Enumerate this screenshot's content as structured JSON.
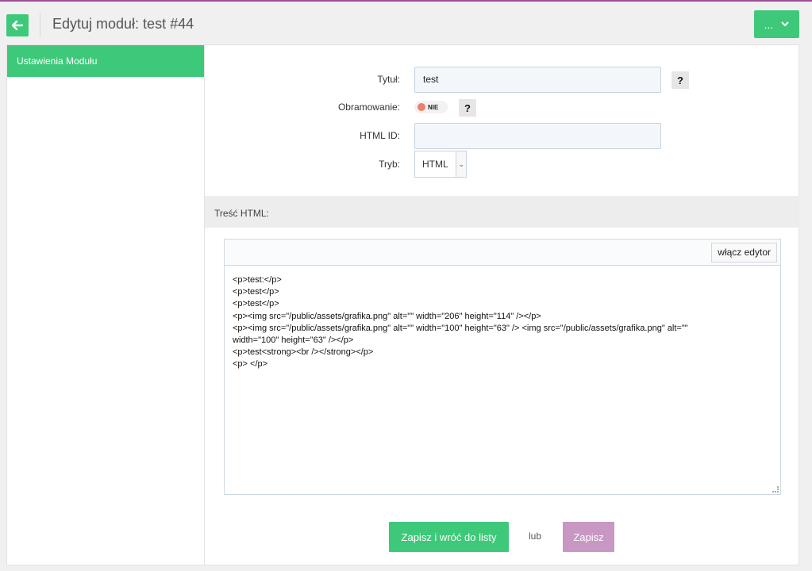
{
  "header": {
    "title": "Edytuj moduł: test #44",
    "more_label": "...",
    "accent_color": "#3ec97a"
  },
  "sidebar": {
    "items": [
      {
        "label": "Ustawienia Modułu",
        "active": true
      }
    ]
  },
  "form": {
    "title_label": "Tytuł:",
    "title_value": "test",
    "border_label": "Obramowanie:",
    "border_toggle": "NIE",
    "help": "?",
    "html_id_label": "HTML ID:",
    "html_id_value": "",
    "mode_label": "Tryb:",
    "mode_value": "HTML"
  },
  "content": {
    "section_label": "Treść HTML:",
    "editor_toggle": "włącz edytor",
    "code": "<p>test:</p>\n<p>test</p>\n<p>test</p>\n<p><img src=\"/public/assets/grafika.png\" alt=\"\" width=\"206\" height=\"114\" /></p>\n<p><img src=\"/public/assets/grafika.png\" alt=\"\" width=\"100\" height=\"63\" /> <img src=\"/public/assets/grafika.png\" alt=\"\"\nwidth=\"100\" height=\"63\" /></p>\n<p>test<strong><br /></strong></p>\n<p> </p>"
  },
  "actions": {
    "save_back": "Zapisz i wróć do listy",
    "or": "lub",
    "save": "Zapisz"
  }
}
